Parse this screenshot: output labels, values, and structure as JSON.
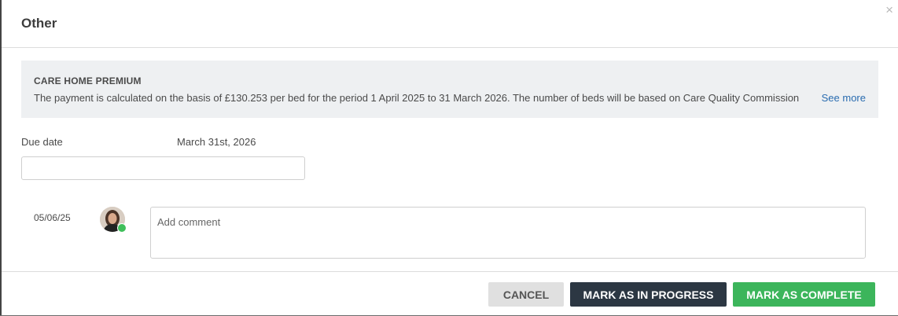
{
  "modal": {
    "title": "Other",
    "close_glyph": "×"
  },
  "info": {
    "heading": "CARE HOME PREMIUM",
    "text": "The payment is calculated on the basis of £130.253 per bed for the period 1 April 2025 to 31 March 2026.  The number of beds will be based on Care Quality Commission",
    "see_more": "See more"
  },
  "due": {
    "label": "Due date",
    "value": "March 31st, 2026",
    "input_value": ""
  },
  "comment": {
    "date": "05/06/25",
    "placeholder": "Add comment",
    "avatar_icon": "user-avatar",
    "status_color": "#3fbf5a"
  },
  "footer": {
    "cancel": "CANCEL",
    "in_progress": "MARK AS IN PROGRESS",
    "complete": "MARK AS COMPLETE"
  },
  "colors": {
    "primary_dark": "#2c3743",
    "success": "#3cb55b",
    "link": "#2a6cb0"
  }
}
